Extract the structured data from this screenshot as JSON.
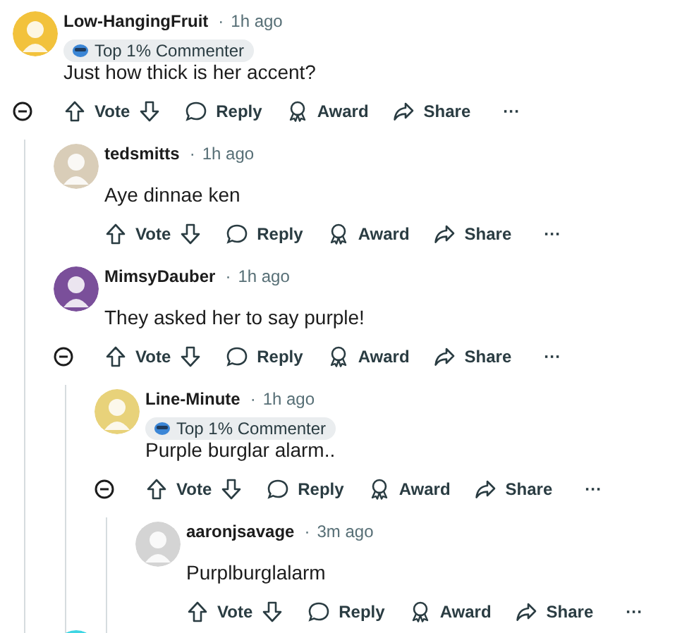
{
  "comments": [
    {
      "author": "Low-HangingFruit",
      "separator": "·",
      "time": "1h ago",
      "badge": "Top 1% Commenter",
      "body": "Just how thick is her accent?",
      "color": "#f2c23c",
      "expanded": true,
      "actions": {
        "vote": "Vote",
        "reply": "Reply",
        "award": "Award",
        "share": "Share",
        "more": "···"
      },
      "children": [
        {
          "author": "tedsmitts",
          "separator": "·",
          "time": "1h ago",
          "body": "Aye dinnae ken",
          "color": "#d9cdb8",
          "actions": {
            "vote": "Vote",
            "reply": "Reply",
            "award": "Award",
            "share": "Share",
            "more": "···"
          }
        },
        {
          "author": "MimsyDauber",
          "separator": "·",
          "time": "1h ago",
          "body": "They asked her to say purple!",
          "color": "#7a4f9a",
          "expanded": true,
          "actions": {
            "vote": "Vote",
            "reply": "Reply",
            "award": "Award",
            "share": "Share",
            "more": "···"
          },
          "children": [
            {
              "author": "Line-Minute",
              "separator": "·",
              "time": "1h ago",
              "badge": "Top 1% Commenter",
              "body": "Purple burglar alarm..",
              "color": "#e8d27a",
              "expanded": true,
              "actions": {
                "vote": "Vote",
                "reply": "Reply",
                "award": "Award",
                "share": "Share",
                "more": "···"
              },
              "children": [
                {
                  "author": "aaronjsavage",
                  "separator": "·",
                  "time": "3m ago",
                  "body": "Purplburglalarm",
                  "color": "#d4d4d4",
                  "actions": {
                    "vote": "Vote",
                    "reply": "Reply",
                    "award": "Award",
                    "share": "Share",
                    "more": "···"
                  }
                }
              ]
            }
          ]
        },
        {
          "kind": "partial",
          "color": "#3fd6e3"
        }
      ]
    }
  ]
}
